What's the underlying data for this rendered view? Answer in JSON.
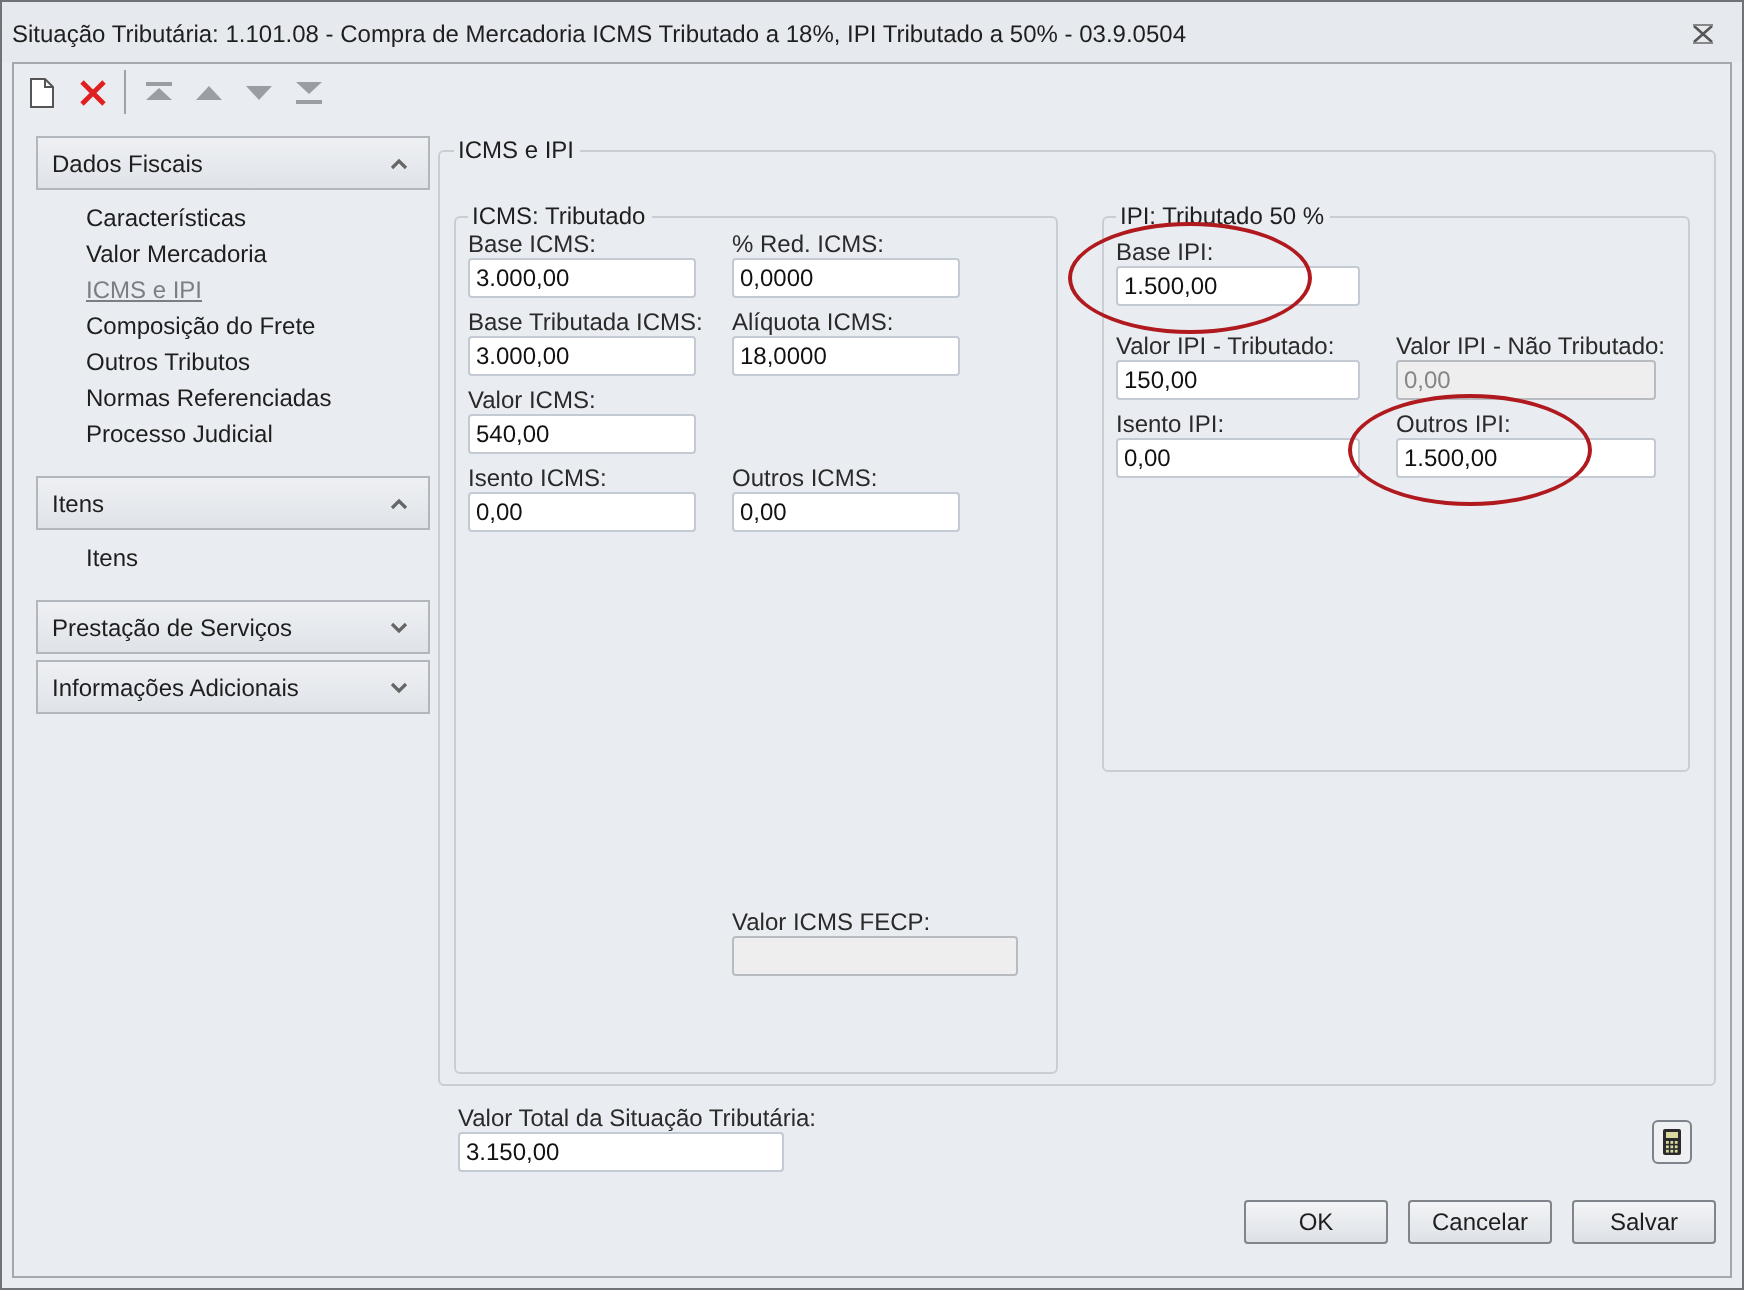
{
  "window": {
    "title": "Situação Tributária: 1.101.08 - Compra de Mercadoria ICMS Tributado a 18%, IPI Tributado a 50% - 03.9.0504"
  },
  "toolbar": [
    {
      "kind": "new"
    },
    {
      "kind": "delete"
    },
    {
      "kind": "separator"
    },
    {
      "kind": "first",
      "disabled": true
    },
    {
      "kind": "previous",
      "disabled": true
    },
    {
      "kind": "next",
      "disabled": true
    },
    {
      "kind": "last",
      "disabled": true
    }
  ],
  "sidebar": {
    "sections": [
      {
        "title": "Dados Fiscais",
        "expanded": true,
        "items": [
          {
            "label": "Características",
            "selected": false
          },
          {
            "label": "Valor Mercadoria",
            "selected": false
          },
          {
            "label": "ICMS e IPI",
            "selected": true
          },
          {
            "label": "Composição do Frete",
            "selected": false
          },
          {
            "label": "Outros Tributos",
            "selected": false
          },
          {
            "label": "Normas Referenciadas",
            "selected": false
          },
          {
            "label": "Processo Judicial",
            "selected": false
          }
        ]
      },
      {
        "title": "Itens",
        "expanded": true,
        "items": [
          {
            "label": "Itens",
            "selected": false
          }
        ]
      },
      {
        "title": "Prestação de Serviços",
        "expanded": false
      },
      {
        "title": "Informações Adicionais",
        "expanded": false
      }
    ]
  },
  "panel": {
    "title": "ICMS e IPI",
    "icms": {
      "title": "ICMS: Tributado",
      "rows": [
        [
          {
            "label": "Base ICMS:",
            "value": "3.000,00",
            "disabled": false
          },
          {
            "label": "% Red. ICMS:",
            "value": "0,0000",
            "disabled": false
          }
        ],
        [
          {
            "label": "Base Tributada ICMS:",
            "value": "3.000,00",
            "disabled": false
          },
          {
            "label": "Alíquota ICMS:",
            "value": "18,0000",
            "disabled": false
          }
        ],
        [
          {
            "label": "Valor ICMS:",
            "value": "540,00",
            "disabled": false
          }
        ],
        [
          {
            "label": "Isento ICMS:",
            "value": "0,00",
            "disabled": false
          },
          {
            "label": "Outros ICMS:",
            "value": "0,00",
            "disabled": false
          }
        ]
      ],
      "fecp": {
        "label": "Valor ICMS FECP:",
        "disabled": true
      }
    },
    "ipi": {
      "title": "IPI: Tributado 50 %",
      "rows": [
        [
          {
            "label": "Base IPI:",
            "value": "1.500,00",
            "disabled": false,
            "circled": true
          }
        ],
        [
          {
            "label": "Valor IPI - Tributado:",
            "value": "150,00",
            "disabled": false
          },
          {
            "label": "Valor IPI - Não Tributado:",
            "value": "0,00",
            "disabled": true
          }
        ],
        [
          {
            "label": "Isento IPI:",
            "value": "0,00",
            "disabled": false
          },
          {
            "label": "Outros IPI:",
            "value": "1.500,00",
            "disabled": false,
            "circled": true
          }
        ]
      ]
    }
  },
  "total": {
    "label": "Valor Total da Situação Tributária:",
    "value": "3.150,00"
  },
  "buttons": [
    "OK",
    "Cancelar",
    "Salvar"
  ]
}
